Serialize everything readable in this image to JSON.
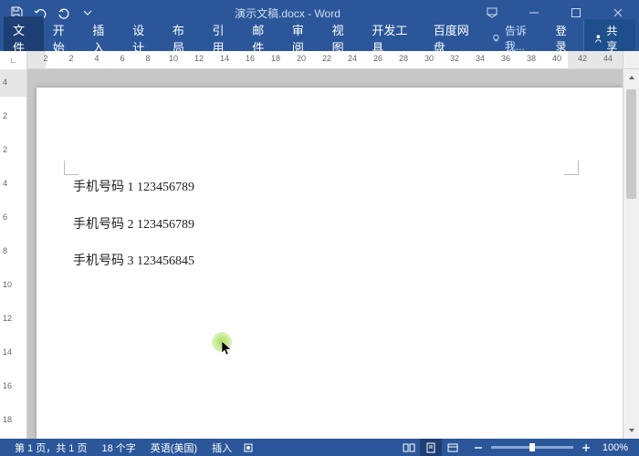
{
  "app": {
    "title": "演示文稿.docx - Word"
  },
  "qat": {
    "save": "save",
    "undo": "undo",
    "redo": "redo"
  },
  "tabs": {
    "file": "文件",
    "home": "开始",
    "insert": "插入",
    "design": "设计",
    "layout": "布局",
    "references": "引用",
    "mailings": "邮件",
    "review": "审阅",
    "view": "视图",
    "devtools": "开发工具",
    "baidu": "百度网盘",
    "tellme": "告诉我...",
    "login": "登录",
    "share": "共享"
  },
  "ruler": {
    "h": [
      "2",
      "2",
      "4",
      "6",
      "8",
      "10",
      "12",
      "14",
      "16",
      "18",
      "20",
      "22",
      "24",
      "26",
      "28",
      "30",
      "32",
      "34",
      "36",
      "38",
      "40",
      "42",
      "44"
    ],
    "v": [
      "4",
      "2",
      "2",
      "4",
      "6",
      "8",
      "10",
      "12",
      "14",
      "16",
      "18"
    ]
  },
  "doc": {
    "lines": [
      "手机号码 1 123456789",
      "手机号码 2 123456789",
      "手机号码 3 123456845"
    ]
  },
  "status": {
    "page": "第 1 页，共 1 页",
    "words": "18 个字",
    "lang": "英语(美国)",
    "mode": "插入",
    "zoom": "100%"
  }
}
